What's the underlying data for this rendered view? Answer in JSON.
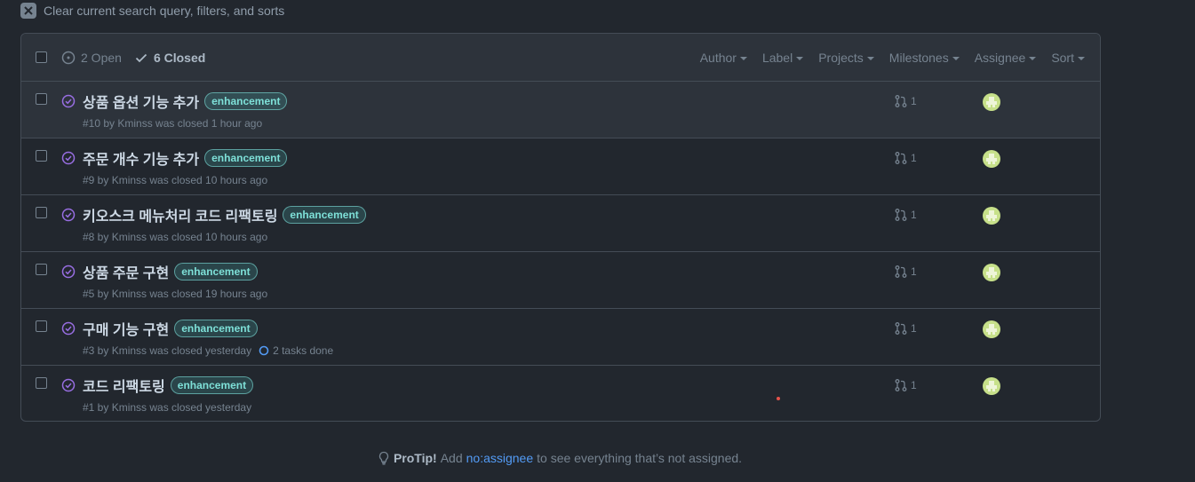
{
  "clear": {
    "label": "Clear current search query, filters, and sorts"
  },
  "header": {
    "open_label": "2 Open",
    "closed_label": "6 Closed",
    "filters": [
      "Author",
      "Label",
      "Projects",
      "Milestones",
      "Assignee",
      "Sort"
    ]
  },
  "issues": [
    {
      "title": "상품 옵션 기능 추가",
      "label": "enhancement",
      "meta": "#10 by Kminss was closed 1 hour ago",
      "prs": "1",
      "tasks": ""
    },
    {
      "title": "주문 개수 기능 추가",
      "label": "enhancement",
      "meta": "#9 by Kminss was closed 10 hours ago",
      "prs": "1",
      "tasks": ""
    },
    {
      "title": "키오스크 메뉴처리 코드 리팩토링",
      "label": "enhancement",
      "meta": "#8 by Kminss was closed 10 hours ago",
      "prs": "1",
      "tasks": ""
    },
    {
      "title": "상품 주문 구현",
      "label": "enhancement",
      "meta": "#5 by Kminss was closed 19 hours ago",
      "prs": "1",
      "tasks": ""
    },
    {
      "title": "구매 기능 구현",
      "label": "enhancement",
      "meta": "#3 by Kminss was closed yesterday",
      "prs": "1",
      "tasks": "2 tasks done"
    },
    {
      "title": "코드 리팩토링",
      "label": "enhancement",
      "meta": "#1 by Kminss was closed yesterday",
      "prs": "1",
      "tasks": ""
    }
  ],
  "protip": {
    "lead": "ProTip!",
    "pre": "Add",
    "link": "no:assignee",
    "post": "to see everything that’s not assigned."
  },
  "colors": {
    "bg": "#22272e",
    "header_bg": "#2d333b",
    "border": "#444c56",
    "closed_purple": "#986ee2",
    "label_text": "#7ee0d8",
    "link": "#539bf5"
  }
}
